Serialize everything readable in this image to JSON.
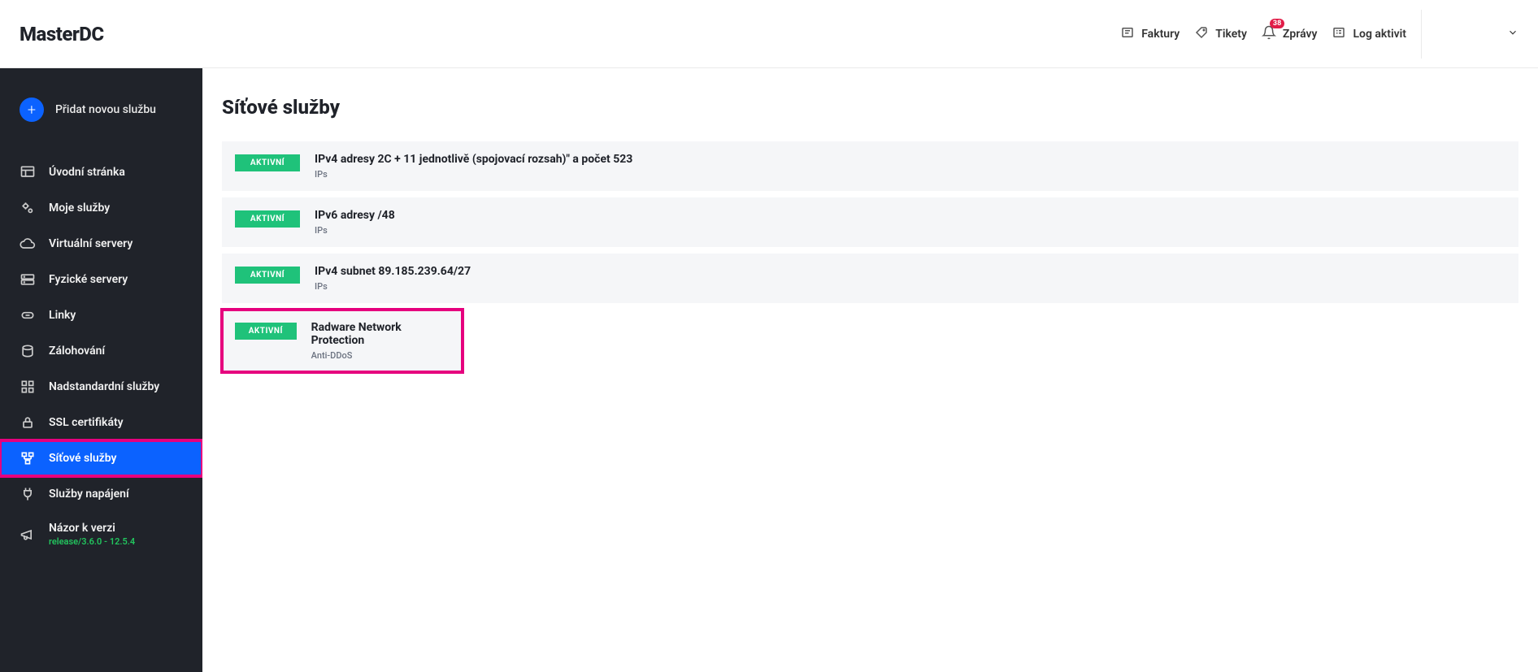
{
  "brand": "MasterDC",
  "topnav": {
    "invoices": "Faktury",
    "tickets": "Tikety",
    "messages": "Zprávy",
    "messages_badge": "38",
    "activity": "Log aktivit"
  },
  "sidebar": {
    "add_label": "Přidat novou službu",
    "items": [
      {
        "label": "Úvodní stránka"
      },
      {
        "label": "Moje služby"
      },
      {
        "label": "Virtuální servery"
      },
      {
        "label": "Fyzické servery"
      },
      {
        "label": "Linky"
      },
      {
        "label": "Zálohování"
      },
      {
        "label": "Nadstandardní služby"
      },
      {
        "label": "SSL certifikáty"
      },
      {
        "label": "Síťové služby",
        "active": true,
        "highlighted": true
      },
      {
        "label": "Služby napájení"
      },
      {
        "label": "Názor k verzi",
        "sub": "release/3.6.0 - 12.5.4"
      }
    ]
  },
  "page": {
    "title": "Síťové služby",
    "services": [
      {
        "status": "AKTIVNÍ",
        "title": "IPv4 adresy 2C + 11 jednotlivě (spojovací rozsah)\" a počet 523",
        "sub": "IPs"
      },
      {
        "status": "AKTIVNÍ",
        "title": "IPv6 adresy /48",
        "sub": "IPs"
      },
      {
        "status": "AKTIVNÍ",
        "title": "IPv4 subnet 89.185.239.64/27",
        "sub": "IPs"
      },
      {
        "status": "AKTIVNÍ",
        "title": "Radware Network Protection",
        "sub": "Anti-DDoS",
        "highlighted": true
      }
    ]
  }
}
